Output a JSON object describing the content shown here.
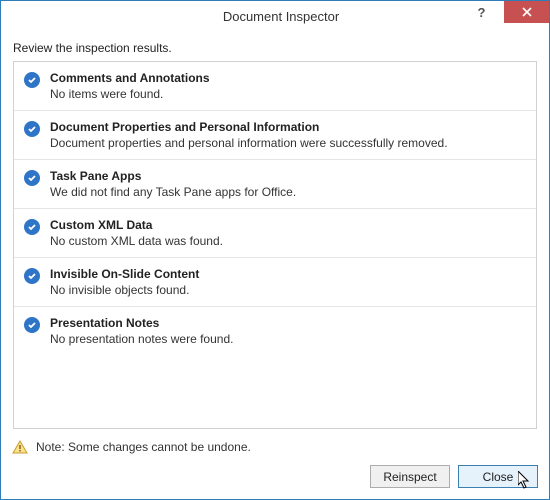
{
  "window": {
    "title": "Document Inspector"
  },
  "instruction": "Review the inspection results.",
  "results": {
    "item0": {
      "title": "Comments and Annotations",
      "desc": "No items were found."
    },
    "item1": {
      "title": "Document Properties and Personal Information",
      "desc": "Document properties and personal information were successfully removed."
    },
    "item2": {
      "title": "Task Pane Apps",
      "desc": "We did not find any Task Pane apps for Office."
    },
    "item3": {
      "title": "Custom XML Data",
      "desc": "No custom XML data was found."
    },
    "item4": {
      "title": "Invisible On-Slide Content",
      "desc": "No invisible objects found."
    },
    "item5": {
      "title": "Presentation Notes",
      "desc": "No presentation notes were found."
    }
  },
  "note": "Note: Some changes cannot be undone.",
  "buttons": {
    "reinspect": "Reinspect",
    "close": "Close"
  },
  "titlebar": {
    "help": "?"
  }
}
